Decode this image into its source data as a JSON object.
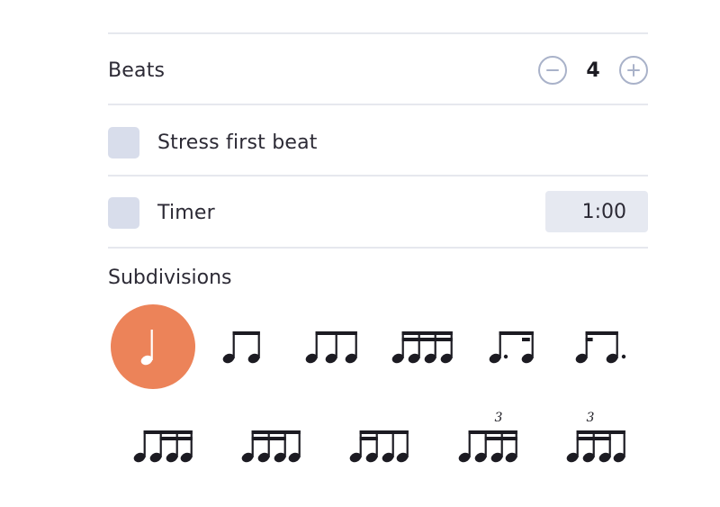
{
  "beats": {
    "label": "Beats",
    "value": "4",
    "minus_icon": "minus-circle-icon",
    "plus_icon": "plus-circle-icon"
  },
  "stress": {
    "label": "Stress first beat",
    "checked": false
  },
  "timer": {
    "label": "Timer",
    "checked": false,
    "value": "1:00"
  },
  "subdivisions": {
    "title": "Subdivisions",
    "selected_color": "#ec8359",
    "items": [
      {
        "icon": "quarter-note-icon",
        "selected": true
      },
      {
        "icon": "two-eighth-notes-icon",
        "selected": false
      },
      {
        "icon": "eighth-note-triplet-icon",
        "selected": false
      },
      {
        "icon": "four-sixteenth-notes-icon",
        "selected": false
      },
      {
        "icon": "dotted-eighth-sixteenth-icon",
        "selected": false
      },
      {
        "icon": "sixteenth-dotted-eighth-icon",
        "selected": false
      },
      {
        "icon": "eighth-two-sixteenths-icon",
        "selected": false
      },
      {
        "icon": "sixteenth-eighth-sixteenth-icon",
        "selected": false
      },
      {
        "icon": "two-sixteenths-eighth-icon",
        "selected": false
      },
      {
        "icon": "sixteenth-triplet-icon",
        "selected": false,
        "tuplet": "3"
      },
      {
        "icon": "sixteenth-triplet-alt-icon",
        "selected": false,
        "tuplet": "3"
      }
    ]
  }
}
